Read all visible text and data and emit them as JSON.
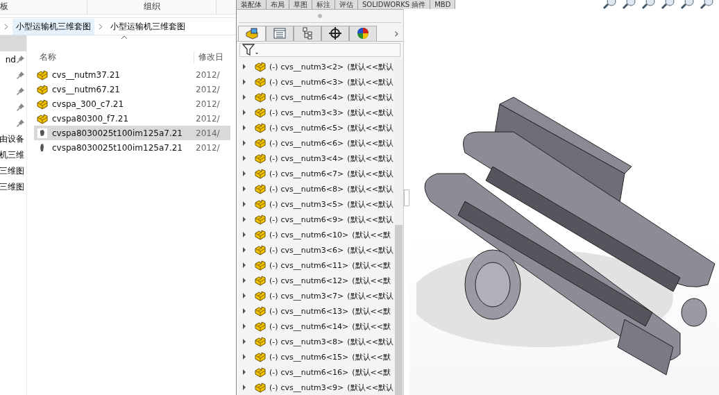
{
  "explorer": {
    "ribbon_groups": [
      "板",
      "组织"
    ],
    "breadcrumb": [
      "小型运输机三维套图",
      "小型运输机三维套图"
    ],
    "nav_items": [
      {
        "label": "nd",
        "pinned": true
      },
      {
        "pinned": true
      },
      {
        "pinned": true
      },
      {
        "pinned": true
      },
      {
        "pinned": true
      },
      {
        "label": "由设备",
        "pinned": false
      },
      {
        "label": "机三维",
        "pinned": false
      },
      {
        "label": "三维图",
        "pinned": false
      },
      {
        "label": "三维图",
        "pinned": false
      }
    ],
    "columns": [
      "名称",
      "修改日"
    ],
    "files": [
      {
        "name": "cvs__nutm37.21",
        "date": "2012/",
        "kind": "part",
        "selected": false
      },
      {
        "name": "cvs__nutm67.21",
        "date": "2012/",
        "kind": "part",
        "selected": false
      },
      {
        "name": "cvspa_300_c7.21",
        "date": "2012/",
        "kind": "part",
        "selected": false
      },
      {
        "name": "cvspa80300_f7.21",
        "date": "2012/",
        "kind": "part",
        "selected": false
      },
      {
        "name": "cvspa8030025t100im125a7.21",
        "date": "2014/",
        "kind": "assembly",
        "selected": true
      },
      {
        "name": "cvspa8030025t100im125a7.21",
        "date": "2012/",
        "kind": "drawing",
        "selected": false
      }
    ]
  },
  "solidworks": {
    "command_tabs": [
      "装配体",
      "布局",
      "草图",
      "标注",
      "评估",
      "SOLIDWORKS 插件",
      "MBD"
    ],
    "manager_tabs": [
      {
        "kind": "feature",
        "selected": true
      },
      {
        "kind": "property",
        "selected": false
      },
      {
        "kind": "config",
        "selected": false
      },
      {
        "kind": "dimxpert",
        "selected": false
      },
      {
        "kind": "display",
        "selected": false
      }
    ],
    "more": "›",
    "tree": [
      {
        "state": "(-)",
        "name": "cvs__nutm3<2>",
        "config": "(默认<<默认"
      },
      {
        "state": "(-)",
        "name": "cvs__nutm6<3>",
        "config": "(默认<<默认"
      },
      {
        "state": "(-)",
        "name": "cvs__nutm6<4>",
        "config": "(默认<<默认"
      },
      {
        "state": "(-)",
        "name": "cvs__nutm3<3>",
        "config": "(默认<<默认"
      },
      {
        "state": "(-)",
        "name": "cvs__nutm6<5>",
        "config": "(默认<<默认"
      },
      {
        "state": "(-)",
        "name": "cvs__nutm6<6>",
        "config": "(默认<<默认"
      },
      {
        "state": "(-)",
        "name": "cvs__nutm3<4>",
        "config": "(默认<<默认"
      },
      {
        "state": "(-)",
        "name": "cvs__nutm6<7>",
        "config": "(默认<<默认"
      },
      {
        "state": "(-)",
        "name": "cvs__nutm6<8>",
        "config": "(默认<<默认"
      },
      {
        "state": "(-)",
        "name": "cvs__nutm3<5>",
        "config": "(默认<<默认"
      },
      {
        "state": "(-)",
        "name": "cvs__nutm6<9>",
        "config": "(默认<<默认"
      },
      {
        "state": "(-)",
        "name": "cvs__nutm6<10>",
        "config": "(默认<<默"
      },
      {
        "state": "(-)",
        "name": "cvs__nutm3<6>",
        "config": "(默认<<默认"
      },
      {
        "state": "(-)",
        "name": "cvs__nutm6<11>",
        "config": "(默认<<默"
      },
      {
        "state": "(-)",
        "name": "cvs__nutm6<12>",
        "config": "(默认<<默"
      },
      {
        "state": "(-)",
        "name": "cvs__nutm3<7>",
        "config": "(默认<<默认"
      },
      {
        "state": "(-)",
        "name": "cvs__nutm6<13>",
        "config": "(默认<<默"
      },
      {
        "state": "(-)",
        "name": "cvs__nutm6<14>",
        "config": "(默认<<默"
      },
      {
        "state": "(-)",
        "name": "cvs__nutm3<8>",
        "config": "(默认<<默认"
      },
      {
        "state": "(-)",
        "name": "cvs__nutm6<15>",
        "config": "(默认<<默"
      },
      {
        "state": "(-)",
        "name": "cvs__nutm6<16>",
        "config": "(默认<<默"
      },
      {
        "state": "(-)",
        "name": "cvs__nutm3<9>",
        "config": "(默认<<默认"
      }
    ]
  }
}
